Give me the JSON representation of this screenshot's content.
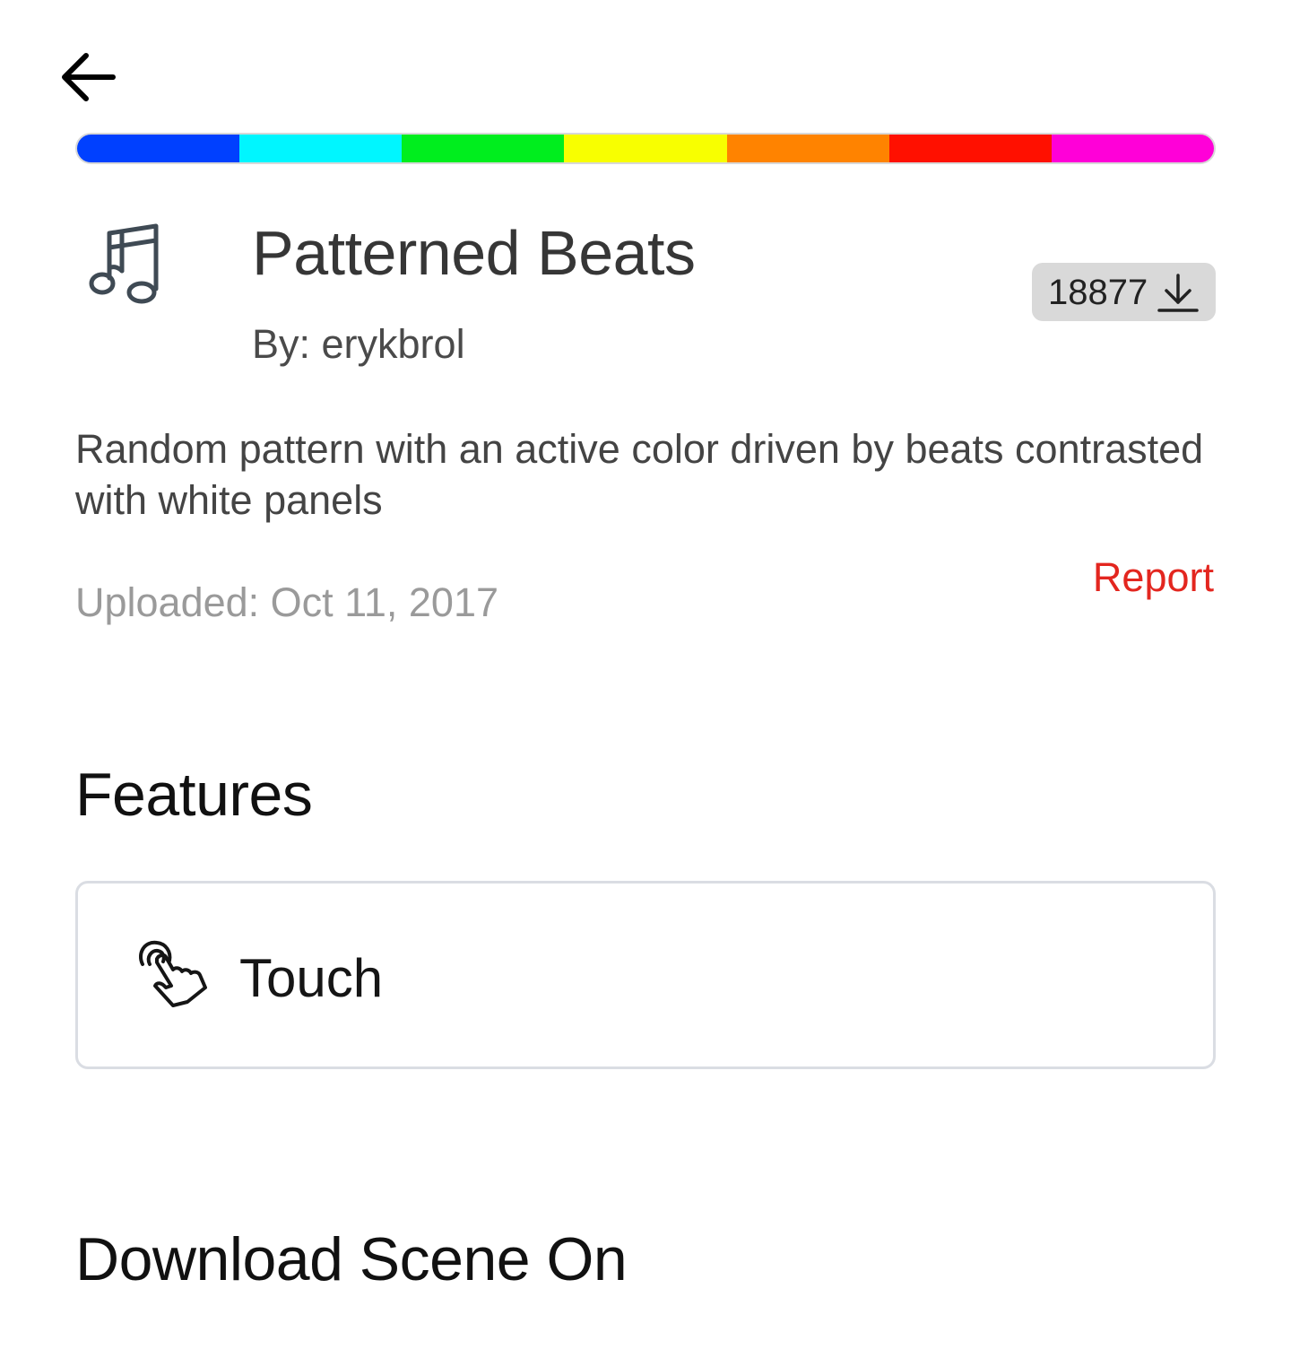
{
  "header": {
    "back_icon": "arrow-left-icon"
  },
  "color_bar": {
    "colors": [
      "#0040ff",
      "#00f6ff",
      "#00ee1e",
      "#f8ff00",
      "#ff8300",
      "#ff1000",
      "#ff00d8"
    ]
  },
  "scene": {
    "icon": "music-note-icon",
    "title": "Patterned Beats",
    "author": "By: erykbrol",
    "download_count": "18877",
    "download_icon": "download-icon",
    "description": "Random pattern with an active color driven by beats contrasted with white panels",
    "report_label": "Report",
    "uploaded": "Uploaded: Oct 11, 2017"
  },
  "features": {
    "heading": "Features",
    "items": [
      {
        "icon": "touch-hand-icon",
        "label": "Touch"
      }
    ]
  },
  "download_section": {
    "heading": "Download Scene On"
  },
  "accent_colors": {
    "report": "#e3261f",
    "icon_slate": "#3f4a54"
  }
}
